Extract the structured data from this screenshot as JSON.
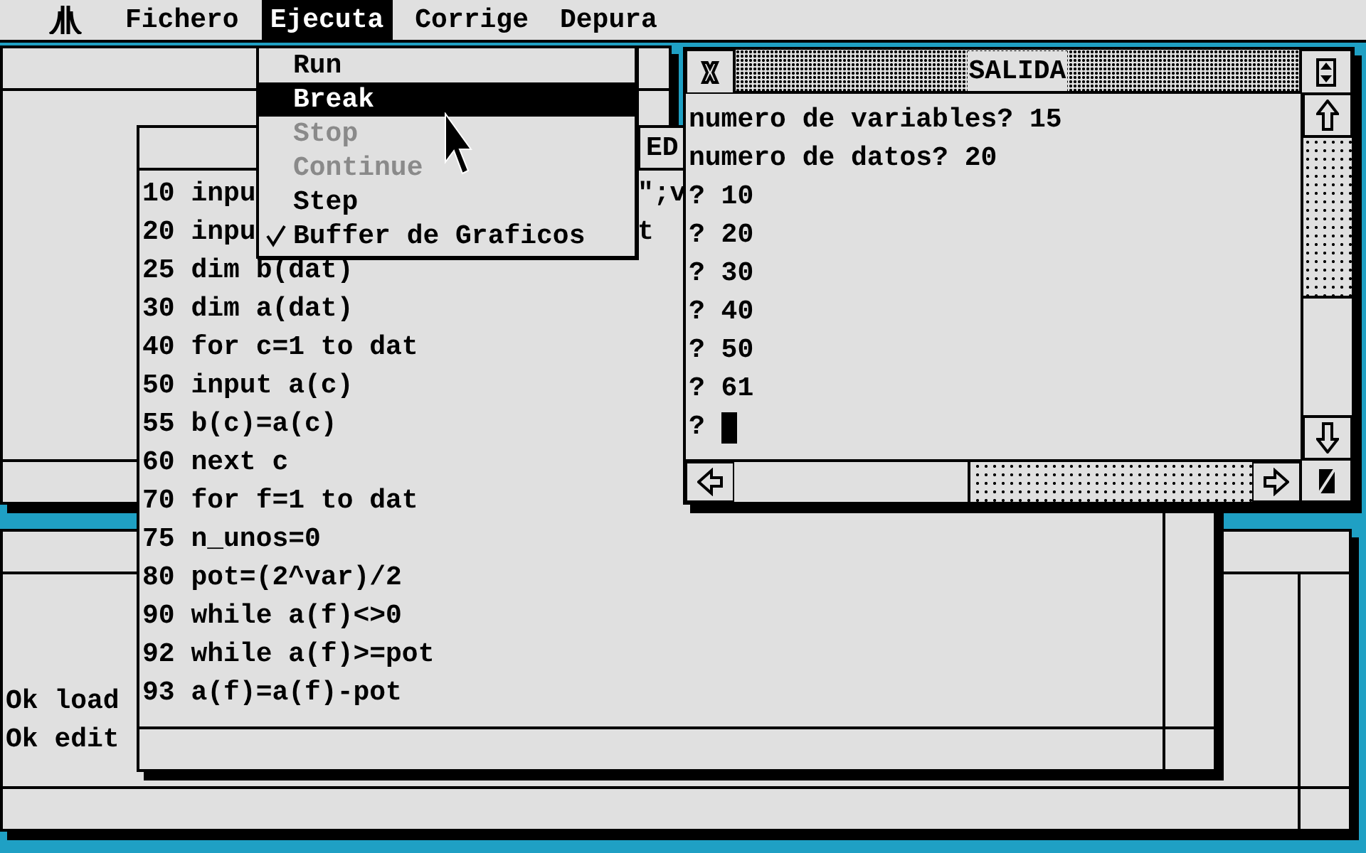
{
  "menu_bar": {
    "items": [
      {
        "label": "Fichero",
        "selected": false
      },
      {
        "label": "Ejecuta",
        "selected": true
      },
      {
        "label": "Corrige",
        "selected": false
      },
      {
        "label": "Depura",
        "selected": false
      }
    ]
  },
  "dropdown": {
    "items": [
      {
        "label": "Run",
        "selected": false,
        "disabled": false,
        "checked": false
      },
      {
        "label": "Break",
        "selected": true,
        "disabled": false,
        "checked": false
      },
      {
        "label": "Stop",
        "selected": false,
        "disabled": true,
        "checked": false
      },
      {
        "label": "Continue",
        "selected": false,
        "disabled": true,
        "checked": false
      },
      {
        "label": "Step",
        "selected": false,
        "disabled": false,
        "checked": false
      },
      {
        "label": "Buffer de Graficos",
        "selected": false,
        "disabled": false,
        "checked": true
      }
    ]
  },
  "command_window": {
    "lines": [
      "Ok load",
      "Ok edit"
    ]
  },
  "edit_window": {
    "title": "ED",
    "lines": [
      {
        "text": "10 inpu",
        "tail": "\";v"
      },
      {
        "text": "20 inpu",
        "tail": "t"
      },
      {
        "text": "25 dim b(dat)"
      },
      {
        "text": "30 dim a(dat)"
      },
      {
        "text": "40 for c=1 to dat"
      },
      {
        "text": "50 input a(c)"
      },
      {
        "text": "55 b(c)=a(c)"
      },
      {
        "text": "60 next c"
      },
      {
        "text": "70 for f=1 to dat"
      },
      {
        "text": "75 n_unos=0"
      },
      {
        "text": "80 pot=(2^var)/2"
      },
      {
        "text": "90 while a(f)<>0"
      },
      {
        "text": "92 while a(f)>=pot"
      },
      {
        "text": "93 a(f)=a(f)-pot"
      }
    ]
  },
  "output_window": {
    "title": "SALIDA",
    "lines": [
      "numero de variables? 15",
      "numero de datos? 20",
      "? 10",
      "? 20",
      "? 30",
      "? 40",
      "? 50",
      "? 61",
      "?"
    ]
  }
}
